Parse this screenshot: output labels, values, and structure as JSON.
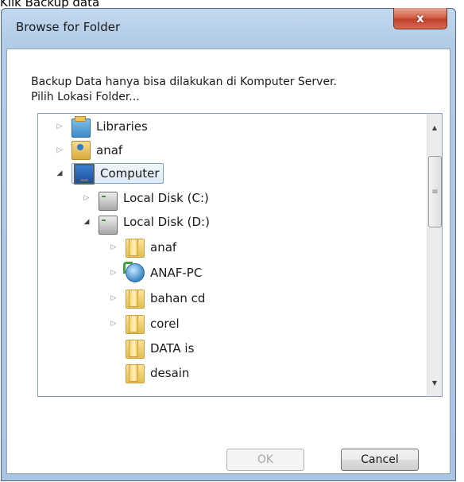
{
  "page_caption": "Klik Backup data",
  "dialog": {
    "title": "Browse for Folder",
    "close_label": "x",
    "message_line1": "Backup Data hanya bisa dilakukan di Komputer Server.",
    "message_line2": "Pilih Lokasi Folder...",
    "tree": {
      "items": [
        {
          "label": "Libraries",
          "icon": "libraries-icon",
          "expanded": false
        },
        {
          "label": "anaf",
          "icon": "user-folder-icon",
          "expanded": false
        },
        {
          "label": "Computer",
          "icon": "computer-icon",
          "expanded": true,
          "selected": true
        },
        {
          "label": "Local Disk (C:)",
          "icon": "hard-disk-icon",
          "expanded": false
        },
        {
          "label": "Local Disk (D:)",
          "icon": "hard-disk-icon",
          "expanded": true
        },
        {
          "label": "anaf",
          "icon": "folder-icon",
          "expanded": false
        },
        {
          "label": "ANAF-PC",
          "icon": "network-computer-icon",
          "expanded": false
        },
        {
          "label": "bahan cd",
          "icon": "folder-icon",
          "expanded": false
        },
        {
          "label": "corel",
          "icon": "folder-icon",
          "expanded": false
        },
        {
          "label": "DATA is",
          "icon": "folder-icon",
          "expanded": null
        },
        {
          "label": "desain",
          "icon": "folder-icon",
          "expanded": null
        }
      ]
    },
    "ok_label": "OK",
    "ok_disabled": true,
    "cancel_label": "Cancel"
  }
}
